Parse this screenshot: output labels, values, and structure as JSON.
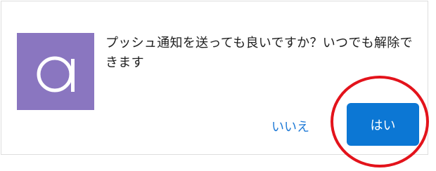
{
  "dialog": {
    "app_icon": "app-logo-letter-a-icon",
    "message": "プッシュ通知を送っても良いですか？いつでも解除できます",
    "no_label": "いいえ",
    "yes_label": "はい"
  },
  "annotation": {
    "shape": "ellipse",
    "target": "yes-button"
  },
  "colors": {
    "logo_bg": "#8a76c0",
    "yes_bg": "#0c77d4",
    "no_text": "#1f7ad6",
    "annotation": "#e3131b"
  }
}
